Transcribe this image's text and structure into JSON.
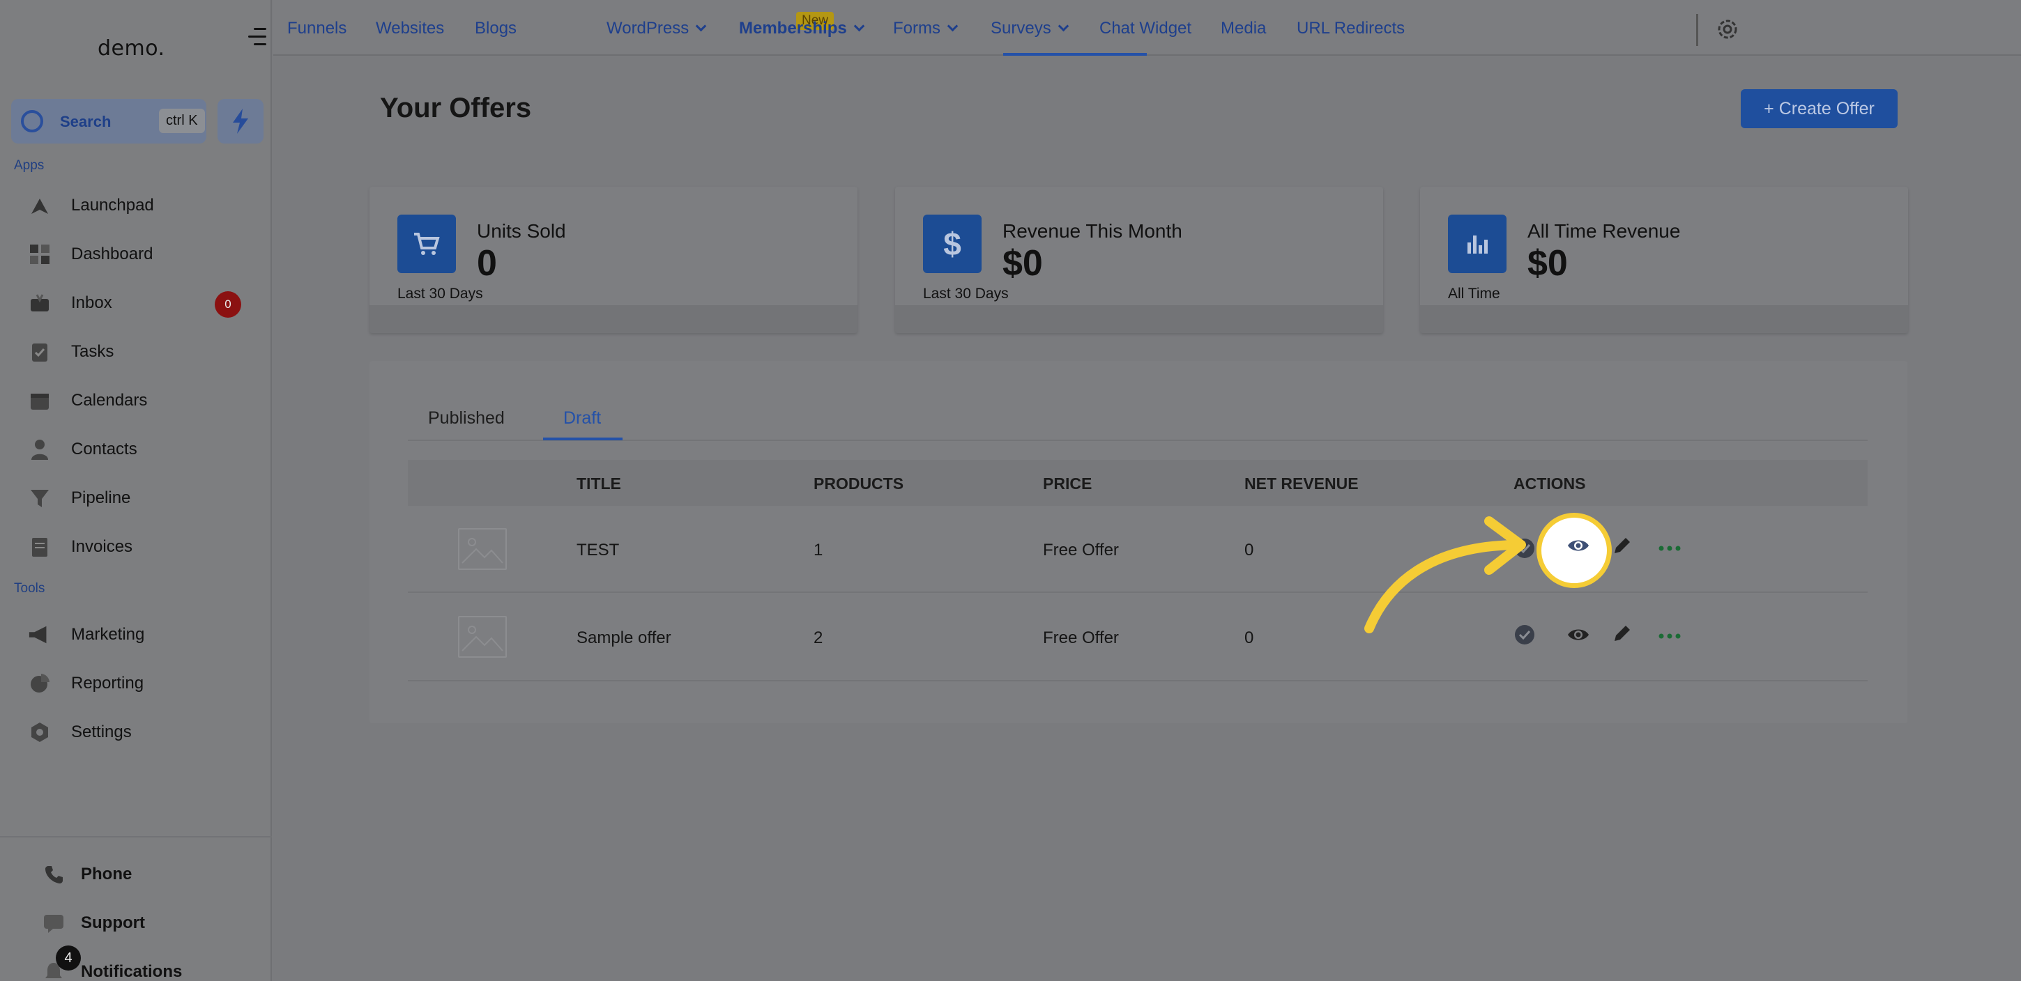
{
  "sidebar": {
    "logo": "demo.",
    "search_label": "Search",
    "search_shortcut": "ctrl K",
    "apps_title": "Apps",
    "tools_title": "Tools",
    "apps": [
      {
        "label": "Launchpad",
        "icon": "rocket-icon"
      },
      {
        "label": "Dashboard",
        "icon": "grid-icon"
      },
      {
        "label": "Inbox",
        "icon": "inbox-icon",
        "badge": "0"
      },
      {
        "label": "Tasks",
        "icon": "clipboard-icon"
      },
      {
        "label": "Calendars",
        "icon": "calendar-icon"
      },
      {
        "label": "Contacts",
        "icon": "person-icon"
      },
      {
        "label": "Pipeline",
        "icon": "funnel-icon"
      },
      {
        "label": "Invoices",
        "icon": "invoice-icon"
      }
    ],
    "tools": [
      {
        "label": "Marketing",
        "icon": "megaphone-icon"
      },
      {
        "label": "Reporting",
        "icon": "pie-chart-icon"
      },
      {
        "label": "Settings",
        "icon": "hexagon-gear-icon"
      }
    ],
    "bottom": [
      {
        "label": "Phone",
        "icon": "phone-icon"
      },
      {
        "label": "Support",
        "icon": "chat-icon"
      },
      {
        "label": "Notifications",
        "icon": "bell-icon",
        "badge": "4"
      }
    ]
  },
  "topnav": {
    "items": [
      {
        "label": "Funnels"
      },
      {
        "label": "Websites"
      },
      {
        "label": "Blogs",
        "badge": "New"
      },
      {
        "label": "WordPress",
        "dropdown": true
      },
      {
        "label": "Memberships",
        "dropdown": true,
        "active": true
      },
      {
        "label": "Forms",
        "dropdown": true
      },
      {
        "label": "Surveys",
        "dropdown": true
      },
      {
        "label": "Chat Widget"
      },
      {
        "label": "Media"
      },
      {
        "label": "URL Redirects"
      }
    ],
    "settings_icon": "gear-icon"
  },
  "main": {
    "title": "Your Offers",
    "create_button": "+ Create Offer",
    "stats": [
      {
        "label": "Units Sold",
        "value": "0",
        "sub": "Last 30 Days",
        "icon": "cart-icon"
      },
      {
        "label": "Revenue This Month",
        "value": "$0",
        "sub": "Last 30 Days",
        "icon": "dollar-icon"
      },
      {
        "label": "All Time Revenue",
        "value": "$0",
        "sub": "All Time",
        "icon": "bar-chart-icon"
      }
    ],
    "tabs": [
      {
        "label": "Published"
      },
      {
        "label": "Draft",
        "active": true
      }
    ],
    "table": {
      "columns": [
        "TITLE",
        "PRODUCTS",
        "PRICE",
        "NET REVENUE",
        "ACTIONS"
      ],
      "rows": [
        {
          "title": "TEST",
          "products": "1",
          "price": "Free Offer",
          "net_revenue": "0"
        },
        {
          "title": "Sample offer",
          "products": "2",
          "price": "Free Offer",
          "net_revenue": "0"
        }
      ]
    }
  },
  "colors": {
    "accent": "#2451a8",
    "highlight": "#f5cc35",
    "badge_red": "#8b1111"
  }
}
